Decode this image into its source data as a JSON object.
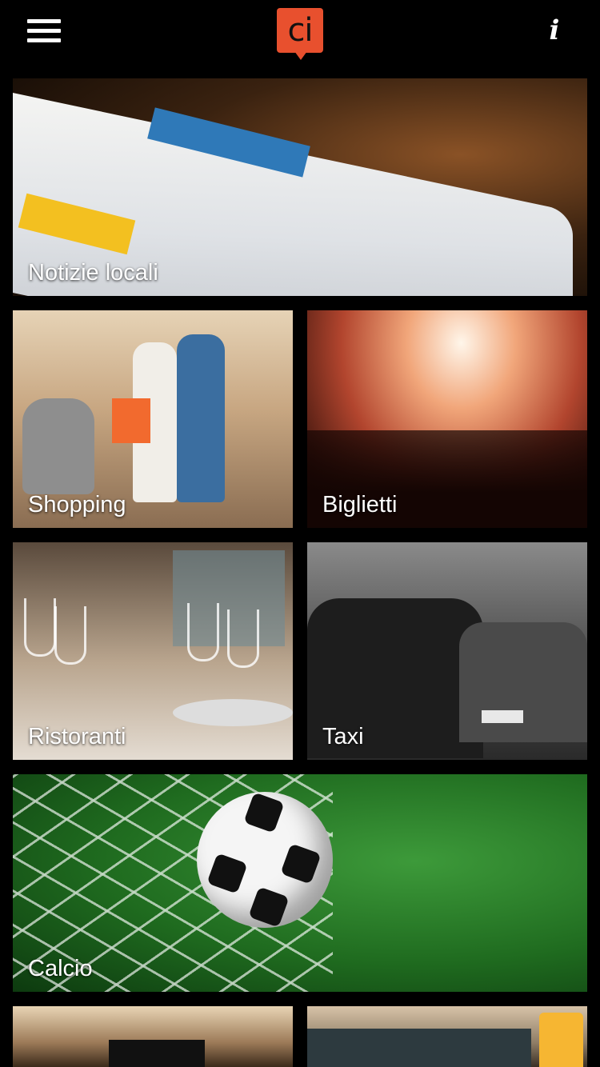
{
  "header": {
    "menu_icon": "hamburger-menu-icon",
    "logo_text": "ci",
    "logo_color": "#e8502e",
    "info_label": "i"
  },
  "tiles": [
    {
      "label": "Notizie locali"
    },
    {
      "label": "Shopping"
    },
    {
      "label": "Biglietti"
    },
    {
      "label": "Ristoranti"
    },
    {
      "label": "Taxi"
    },
    {
      "label": "Calcio"
    },
    {
      "label": ""
    },
    {
      "label": ""
    }
  ]
}
